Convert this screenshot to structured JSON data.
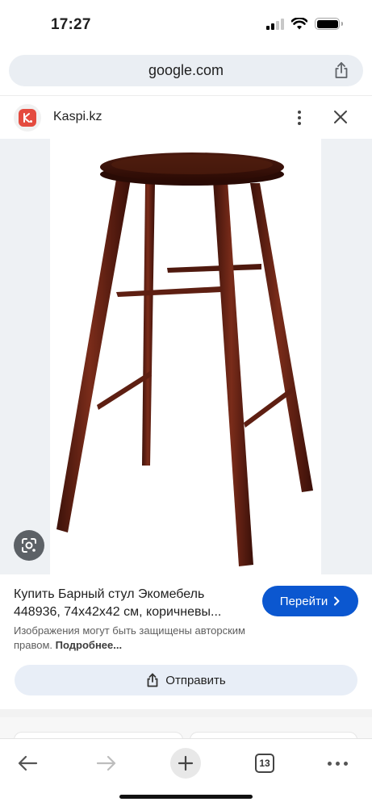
{
  "status_bar": {
    "time": "17:27"
  },
  "url_bar": {
    "url": "google.com",
    "share_icon": "share-icon"
  },
  "source": {
    "name": "Kaspi.kz",
    "logo_icon": "kaspi-logo",
    "more_icon": "more-vert-icon",
    "close_icon": "close-icon"
  },
  "image": {
    "subject": "bar-stool-image",
    "lens_icon": "google-lens-icon"
  },
  "caption": {
    "title": "Купить Барный стул Экомебель 448936, 74х42х42 см, коричневы...",
    "go_button_label": "Перейти",
    "copyright_text": "Изображения могут быть защищены авторским правом.",
    "copyright_more": "Подробнее...",
    "share_label": "Отправить"
  },
  "toolbar": {
    "back_icon": "arrow-left-icon",
    "forward_icon": "arrow-right-icon",
    "new_tab_icon": "plus-icon",
    "tab_count": "13",
    "menu_icon": "more-horiz-icon"
  },
  "colors": {
    "accent": "#0b57d0",
    "kaspi_red": "#e44b3f",
    "stool_brown": "#5a1e12"
  }
}
